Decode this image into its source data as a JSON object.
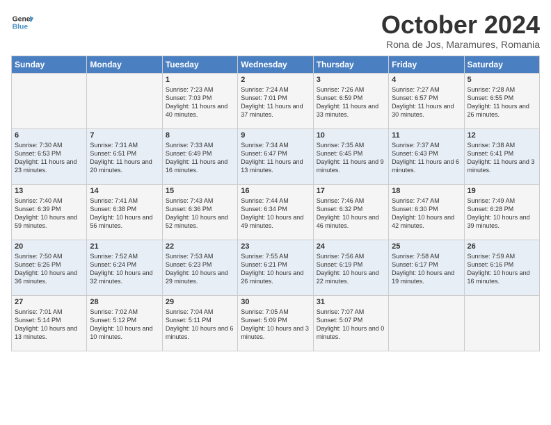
{
  "header": {
    "logo_line1": "General",
    "logo_line2": "Blue",
    "month": "October 2024",
    "location": "Rona de Jos, Maramures, Romania"
  },
  "days_of_week": [
    "Sunday",
    "Monday",
    "Tuesday",
    "Wednesday",
    "Thursday",
    "Friday",
    "Saturday"
  ],
  "weeks": [
    [
      {
        "day": "",
        "info": ""
      },
      {
        "day": "",
        "info": ""
      },
      {
        "day": "1",
        "info": "Sunrise: 7:23 AM\nSunset: 7:03 PM\nDaylight: 11 hours and 40 minutes."
      },
      {
        "day": "2",
        "info": "Sunrise: 7:24 AM\nSunset: 7:01 PM\nDaylight: 11 hours and 37 minutes."
      },
      {
        "day": "3",
        "info": "Sunrise: 7:26 AM\nSunset: 6:59 PM\nDaylight: 11 hours and 33 minutes."
      },
      {
        "day": "4",
        "info": "Sunrise: 7:27 AM\nSunset: 6:57 PM\nDaylight: 11 hours and 30 minutes."
      },
      {
        "day": "5",
        "info": "Sunrise: 7:28 AM\nSunset: 6:55 PM\nDaylight: 11 hours and 26 minutes."
      }
    ],
    [
      {
        "day": "6",
        "info": "Sunrise: 7:30 AM\nSunset: 6:53 PM\nDaylight: 11 hours and 23 minutes."
      },
      {
        "day": "7",
        "info": "Sunrise: 7:31 AM\nSunset: 6:51 PM\nDaylight: 11 hours and 20 minutes."
      },
      {
        "day": "8",
        "info": "Sunrise: 7:33 AM\nSunset: 6:49 PM\nDaylight: 11 hours and 16 minutes."
      },
      {
        "day": "9",
        "info": "Sunrise: 7:34 AM\nSunset: 6:47 PM\nDaylight: 11 hours and 13 minutes."
      },
      {
        "day": "10",
        "info": "Sunrise: 7:35 AM\nSunset: 6:45 PM\nDaylight: 11 hours and 9 minutes."
      },
      {
        "day": "11",
        "info": "Sunrise: 7:37 AM\nSunset: 6:43 PM\nDaylight: 11 hours and 6 minutes."
      },
      {
        "day": "12",
        "info": "Sunrise: 7:38 AM\nSunset: 6:41 PM\nDaylight: 11 hours and 3 minutes."
      }
    ],
    [
      {
        "day": "13",
        "info": "Sunrise: 7:40 AM\nSunset: 6:39 PM\nDaylight: 10 hours and 59 minutes."
      },
      {
        "day": "14",
        "info": "Sunrise: 7:41 AM\nSunset: 6:38 PM\nDaylight: 10 hours and 56 minutes."
      },
      {
        "day": "15",
        "info": "Sunrise: 7:43 AM\nSunset: 6:36 PM\nDaylight: 10 hours and 52 minutes."
      },
      {
        "day": "16",
        "info": "Sunrise: 7:44 AM\nSunset: 6:34 PM\nDaylight: 10 hours and 49 minutes."
      },
      {
        "day": "17",
        "info": "Sunrise: 7:46 AM\nSunset: 6:32 PM\nDaylight: 10 hours and 46 minutes."
      },
      {
        "day": "18",
        "info": "Sunrise: 7:47 AM\nSunset: 6:30 PM\nDaylight: 10 hours and 42 minutes."
      },
      {
        "day": "19",
        "info": "Sunrise: 7:49 AM\nSunset: 6:28 PM\nDaylight: 10 hours and 39 minutes."
      }
    ],
    [
      {
        "day": "20",
        "info": "Sunrise: 7:50 AM\nSunset: 6:26 PM\nDaylight: 10 hours and 36 minutes."
      },
      {
        "day": "21",
        "info": "Sunrise: 7:52 AM\nSunset: 6:24 PM\nDaylight: 10 hours and 32 minutes."
      },
      {
        "day": "22",
        "info": "Sunrise: 7:53 AM\nSunset: 6:23 PM\nDaylight: 10 hours and 29 minutes."
      },
      {
        "day": "23",
        "info": "Sunrise: 7:55 AM\nSunset: 6:21 PM\nDaylight: 10 hours and 26 minutes."
      },
      {
        "day": "24",
        "info": "Sunrise: 7:56 AM\nSunset: 6:19 PM\nDaylight: 10 hours and 22 minutes."
      },
      {
        "day": "25",
        "info": "Sunrise: 7:58 AM\nSunset: 6:17 PM\nDaylight: 10 hours and 19 minutes."
      },
      {
        "day": "26",
        "info": "Sunrise: 7:59 AM\nSunset: 6:16 PM\nDaylight: 10 hours and 16 minutes."
      }
    ],
    [
      {
        "day": "27",
        "info": "Sunrise: 7:01 AM\nSunset: 5:14 PM\nDaylight: 10 hours and 13 minutes."
      },
      {
        "day": "28",
        "info": "Sunrise: 7:02 AM\nSunset: 5:12 PM\nDaylight: 10 hours and 10 minutes."
      },
      {
        "day": "29",
        "info": "Sunrise: 7:04 AM\nSunset: 5:11 PM\nDaylight: 10 hours and 6 minutes."
      },
      {
        "day": "30",
        "info": "Sunrise: 7:05 AM\nSunset: 5:09 PM\nDaylight: 10 hours and 3 minutes."
      },
      {
        "day": "31",
        "info": "Sunrise: 7:07 AM\nSunset: 5:07 PM\nDaylight: 10 hours and 0 minutes."
      },
      {
        "day": "",
        "info": ""
      },
      {
        "day": "",
        "info": ""
      }
    ]
  ]
}
